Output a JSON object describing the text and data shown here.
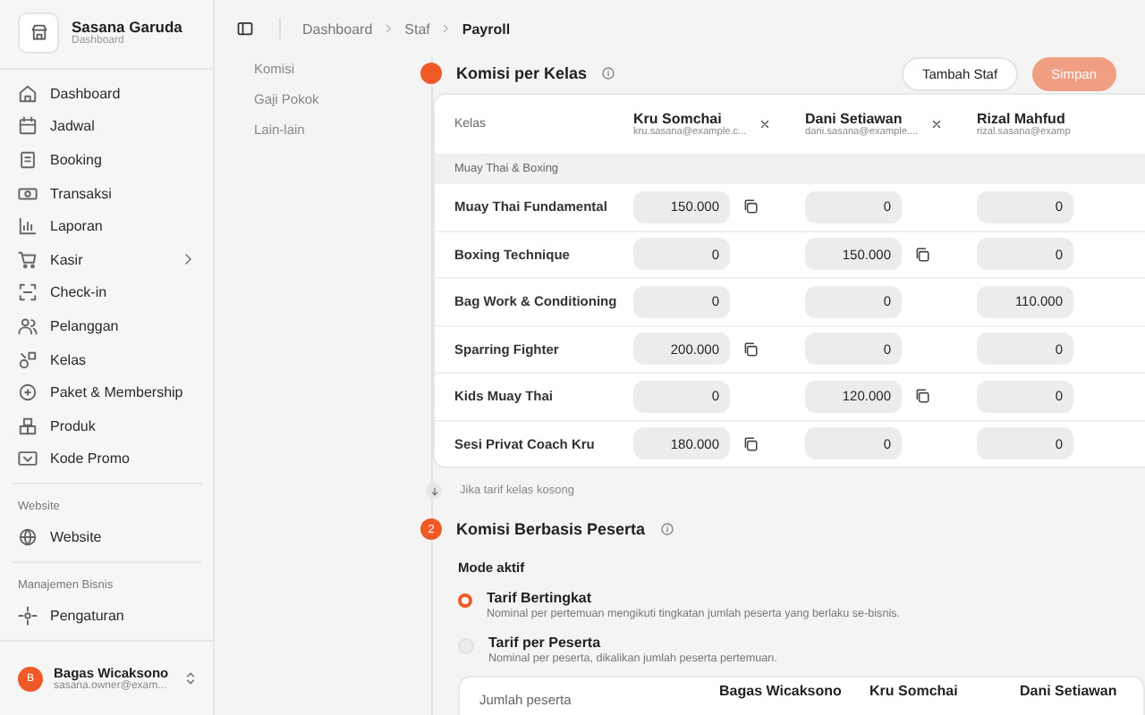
{
  "sidebar": {
    "brand": {
      "name": "Sasana Garuda",
      "subtitle": "Dashboard"
    },
    "nav": [
      {
        "label": "Dashboard",
        "expandable": false
      },
      {
        "label": "Jadwal",
        "expandable": false
      },
      {
        "label": "Booking",
        "expandable": false
      },
      {
        "label": "Transaksi",
        "expandable": false
      },
      {
        "label": "Laporan",
        "expandable": false
      },
      {
        "label": "Kasir",
        "expandable": true
      },
      {
        "label": "Check-in",
        "expandable": false
      },
      {
        "label": "Pelanggan",
        "expandable": false
      },
      {
        "label": "Kelas",
        "expandable": false
      },
      {
        "label": "Paket & Membership",
        "expandable": false
      },
      {
        "label": "Produk",
        "expandable": false
      },
      {
        "label": "Kode Promo",
        "expandable": false
      }
    ],
    "groups": [
      {
        "label": "Website",
        "items": [
          "Website"
        ]
      },
      {
        "label": "Manajemen Bisnis",
        "items": [
          "Pengaturan"
        ]
      }
    ],
    "user": {
      "initial": "B",
      "name": "Bagas Wicaksono",
      "email": "sasana.owner@exam..."
    }
  },
  "breadcrumb": [
    "Dashboard",
    "Staf",
    "Payroll"
  ],
  "subnav": [
    {
      "label": "Komisi",
      "selected": false
    },
    {
      "label": "Gaji Pokok",
      "selected": false
    },
    {
      "label": "Lain-lain",
      "selected": false
    }
  ],
  "section_1": {
    "title": "Komisi per Kelas",
    "buttons": [
      {
        "label": "Tambah Staf",
        "kind": "secondary",
        "disabled": false
      },
      {
        "label": "Simpan",
        "kind": "primary",
        "disabled": true
      }
    ],
    "table": {
      "first_column": "Kelas",
      "staff": [
        {
          "name": "Kru Somchai",
          "email": "kru.sasana@example.c...",
          "removable": true
        },
        {
          "name": "Dani Setiawan",
          "email": "dani.sasana@example....",
          "removable": true
        },
        {
          "name": "Rizal Mahfud",
          "email": "rizal.sasana@examp",
          "removable": false
        }
      ],
      "group": "Muay Thai & Boxing",
      "rows": [
        {
          "name": "Muay Thai Fundamental",
          "cells": [
            {
              "value": "150.000",
              "copy": true
            },
            {
              "value": "0",
              "copy": false
            },
            {
              "value": "0",
              "copy": false
            }
          ]
        },
        {
          "name": "Boxing Technique",
          "cells": [
            {
              "value": "0",
              "copy": false
            },
            {
              "value": "150.000",
              "copy": true
            },
            {
              "value": "0",
              "copy": false
            }
          ]
        },
        {
          "name": "Bag Work & Conditioning",
          "cells": [
            {
              "value": "0",
              "copy": false
            },
            {
              "value": "0",
              "copy": false
            },
            {
              "value": "110.000",
              "copy": false
            }
          ]
        },
        {
          "name": "Sparring Fighter",
          "cells": [
            {
              "value": "200.000",
              "copy": true
            },
            {
              "value": "0",
              "copy": false
            },
            {
              "value": "0",
              "copy": false
            }
          ]
        },
        {
          "name": "Kids Muay Thai",
          "cells": [
            {
              "value": "0",
              "copy": false
            },
            {
              "value": "120.000",
              "copy": true
            },
            {
              "value": "0",
              "copy": false
            }
          ]
        },
        {
          "name": "Sesi Privat Coach Kru",
          "cells": [
            {
              "value": "180.000",
              "copy": true
            },
            {
              "value": "0",
              "copy": false
            },
            {
              "value": "0",
              "copy": false
            }
          ]
        }
      ]
    },
    "note": "Jika tarif kelas kosong"
  },
  "section_2": {
    "number": "2",
    "title": "Komisi Berbasis Peserta",
    "mode_label": "Mode aktif",
    "options": [
      {
        "title": "Tarif Bertingkat",
        "description": "Nominal per pertemuan mengikuti tingkatan jumlah peserta yang berlaku se-bisnis.",
        "selected": true
      },
      {
        "title": "Tarif per Peserta",
        "description": "Nominal per peserta, dikalikan jumlah peserta pertemuan.",
        "selected": false
      }
    ],
    "table": {
      "columns": [
        "Jumlah peserta",
        "Bagas Wicaksono",
        "Kru Somchai",
        "Dani Setiawan"
      ]
    }
  }
}
